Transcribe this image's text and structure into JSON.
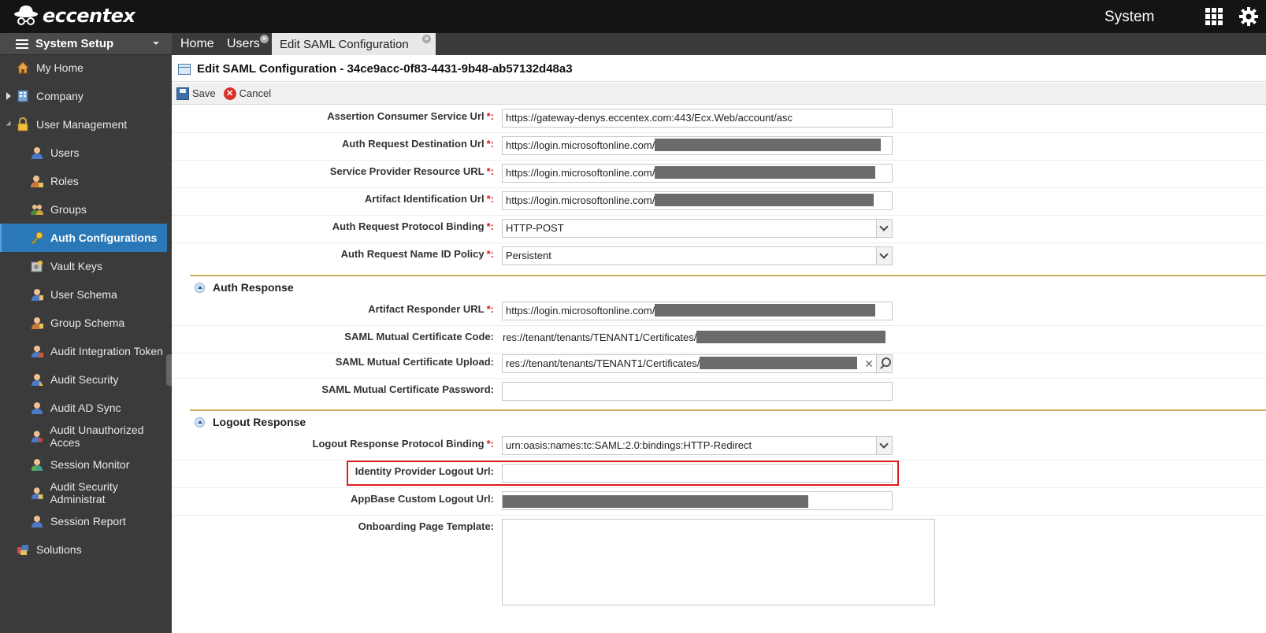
{
  "app": {
    "logo_text": "eccentex",
    "context_label": "System"
  },
  "sidebar": {
    "header": "System Setup",
    "items": [
      {
        "label": "My Home",
        "icon": "home-icon"
      },
      {
        "label": "Company",
        "icon": "building-icon"
      },
      {
        "label": "User Management",
        "icon": "lock-icon"
      },
      {
        "label": "Users",
        "icon": "user-icon"
      },
      {
        "label": "Roles",
        "icon": "roles-icon"
      },
      {
        "label": "Groups",
        "icon": "groups-icon"
      },
      {
        "label": "Auth Configurations",
        "icon": "key-icon",
        "active": true
      },
      {
        "label": "Vault Keys",
        "icon": "vault-icon"
      },
      {
        "label": "User Schema",
        "icon": "user-schema-icon"
      },
      {
        "label": "Group Schema",
        "icon": "group-schema-icon"
      },
      {
        "label": "Audit Integration Token",
        "icon": "audit-icon"
      },
      {
        "label": "Audit Security",
        "icon": "audit-icon"
      },
      {
        "label": "Audit AD Sync",
        "icon": "audit-icon"
      },
      {
        "label": "Audit Unauthorized Acces",
        "icon": "audit-icon"
      },
      {
        "label": "Session Monitor",
        "icon": "monitor-icon"
      },
      {
        "label": "Audit Security Administrat",
        "icon": "audit-icon"
      },
      {
        "label": "Session Report",
        "icon": "report-icon"
      },
      {
        "label": "Solutions",
        "icon": "solutions-icon"
      }
    ]
  },
  "tabs": [
    {
      "label": "Home"
    },
    {
      "label": "Users"
    },
    {
      "label": "Edit SAML Configuration",
      "active": true
    }
  ],
  "page": {
    "title": "Edit SAML Configuration - 34ce9acc-0f83-4431-9b48-ab57132d48a3",
    "save_label": "Save",
    "cancel_label": "Cancel"
  },
  "form": {
    "acs_url": {
      "label": "Assertion Consumer Service Url",
      "value": "https://gateway-denys.eccentex.com:443/Ecx.Web/account/asc"
    },
    "auth_dest_url": {
      "label": "Auth Request Destination Url",
      "value": "https://login.microsoftonline.com/"
    },
    "sp_resource_url": {
      "label": "Service Provider Resource URL",
      "value": "https://login.microsoftonline.com/"
    },
    "artifact_id_url": {
      "label": "Artifact Identification Url",
      "value": "https://login.microsoftonline.com/"
    },
    "protocol_binding": {
      "label": "Auth Request Protocol Binding",
      "value": "HTTP-POST"
    },
    "name_id_policy": {
      "label": "Auth Request Name ID Policy",
      "value": "Persistent"
    },
    "auth_response_section": "Auth Response",
    "artifact_responder_url": {
      "label": "Artifact Responder URL",
      "value": "https://login.microsoftonline.com/"
    },
    "cert_code": {
      "label": "SAML Mutual Certificate Code:",
      "value": "res://tenant/tenants/TENANT1/Certificates/"
    },
    "cert_upload": {
      "label": "SAML Mutual Certificate Upload:",
      "value": "res://tenant/tenants/TENANT1/Certificates/"
    },
    "cert_password": {
      "label": "SAML Mutual Certificate Password:",
      "value": ""
    },
    "logout_response_section": "Logout Response",
    "logout_binding": {
      "label": "Logout Response Protocol Binding",
      "value": "urn:oasis:names:tc:SAML:2.0:bindings:HTTP-Redirect"
    },
    "idp_logout_url": {
      "label": "Identity Provider Logout Url:",
      "value": ""
    },
    "appbase_logout_url": {
      "label": "AppBase Custom Logout Url:",
      "value": ""
    },
    "onboarding_template": {
      "label": "Onboarding Page Template:",
      "value": ""
    }
  },
  "colors": {
    "active_item": "#2b78b8",
    "required": "#d21e1e",
    "highlight": "#e01b1b",
    "section_rule": "#c8b060"
  }
}
